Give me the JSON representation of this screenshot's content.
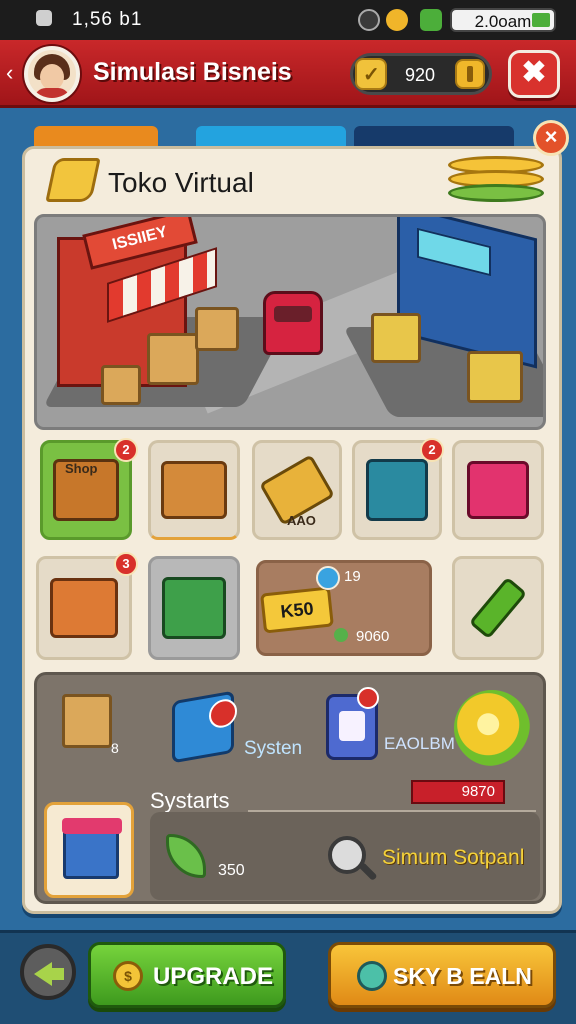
{
  "status_bar": {
    "time": "1,56 b1",
    "battery": "2.0oam"
  },
  "header": {
    "title": "Simulasi Bisneis",
    "coins": "920",
    "back_glyph": "‹",
    "close_glyph": "✖"
  },
  "panel": {
    "title": "Toko Virtual",
    "close_glyph": "×"
  },
  "scene": {
    "shop_sign": "ISSIIEY"
  },
  "items": [
    {
      "label": "Shop",
      "badge": "2",
      "color": "#7ac043"
    },
    {
      "label": "",
      "badge": ""
    },
    {
      "label": "AAO",
      "badge": ""
    },
    {
      "label": "",
      "badge": "2"
    },
    {
      "label": "",
      "badge": ""
    },
    {
      "label": "",
      "badge": "3"
    },
    {
      "label": "",
      "badge": ""
    },
    {
      "label": "",
      "badge": ""
    }
  ],
  "promo": {
    "tag": "K50",
    "count": "19",
    "price": "9060"
  },
  "lower": {
    "box_count": "8",
    "system_label": "Systen",
    "ebaum_label": "EAOLBM",
    "section_title": "Systarts",
    "red_value": "9870",
    "leaf_value": "350",
    "simum_label": "Simum Sotpanl"
  },
  "buttons": {
    "upgrade": "UPGRADE",
    "upgrade_coin": "$",
    "buy": "SKY B EALN"
  },
  "colors": {
    "header_red": "#c9282a",
    "upgrade_green": "#5cbd2e",
    "buy_orange": "#f2a826",
    "panel_bg": "#f4ecdc"
  }
}
